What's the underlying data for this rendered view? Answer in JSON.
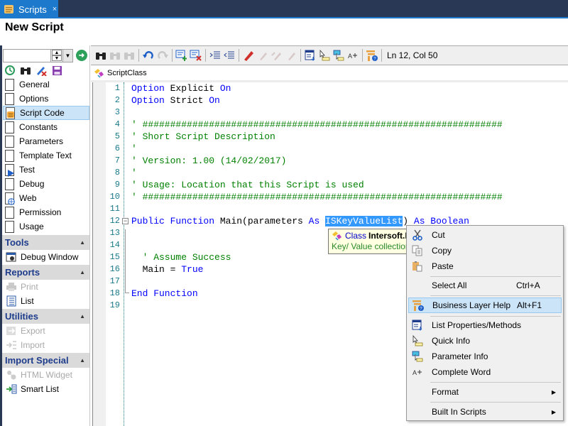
{
  "tab": {
    "label": "Scripts",
    "close_glyph": "×",
    "icon": "scroll-icon"
  },
  "document": {
    "title": "New Script"
  },
  "left_panel": {
    "search": {
      "value": "",
      "placeholder": ""
    },
    "tools_icons": [
      "history-icon",
      "binoculars-icon",
      "edit-delete-icon",
      "save-icon"
    ],
    "nav_items": [
      {
        "label": "General",
        "icon": "checkbox-icon",
        "selected": false
      },
      {
        "label": "Options",
        "icon": "checkbox-icon",
        "selected": false
      },
      {
        "label": "Script Code",
        "icon": "script-code-icon",
        "selected": true
      },
      {
        "label": "Constants",
        "icon": "checkbox-icon",
        "selected": false
      },
      {
        "label": "Parameters",
        "icon": "checkbox-icon",
        "selected": false
      },
      {
        "label": "Template Text",
        "icon": "checkbox-icon",
        "selected": false
      },
      {
        "label": "Test",
        "icon": "play-page-icon",
        "selected": false
      },
      {
        "label": "Debug",
        "icon": "checkbox-icon",
        "selected": false
      },
      {
        "label": "Web",
        "icon": "globe-page-icon",
        "selected": false
      },
      {
        "label": "Permission",
        "icon": "checkbox-icon",
        "selected": false
      },
      {
        "label": "Usage",
        "icon": "checkbox-icon",
        "selected": false
      }
    ],
    "sections": [
      {
        "title": "Tools",
        "caret": "▲",
        "items": [
          {
            "label": "Debug Window",
            "icon": "debug-window-icon",
            "enabled": true
          }
        ]
      },
      {
        "title": "Reports",
        "caret": "▲",
        "items": [
          {
            "label": "Print",
            "icon": "printer-icon",
            "enabled": false
          },
          {
            "label": "List",
            "icon": "list-icon",
            "enabled": true
          }
        ]
      },
      {
        "title": "Utilities",
        "caret": "▲",
        "items": [
          {
            "label": "Export",
            "icon": "export-icon",
            "enabled": false
          },
          {
            "label": "Import",
            "icon": "import-icon",
            "enabled": false
          }
        ]
      },
      {
        "title": "Import Special",
        "caret": "▲",
        "items": [
          {
            "label": "HTML Widget",
            "icon": "html-widget-icon",
            "enabled": false
          },
          {
            "label": "Smart List",
            "icon": "smart-list-icon",
            "enabled": true
          }
        ]
      }
    ]
  },
  "toolbar": {
    "buttons": [
      "find-icon",
      "find-previous-icon",
      "find-next-icon",
      "undo-icon",
      "redo-icon",
      "comment-icon",
      "uncomment-icon",
      "indent-icon",
      "outdent-icon",
      "bookmark-icon",
      "prev-bookmark-icon",
      "next-bookmark-icon",
      "clear-bookmarks-icon",
      "list-members-icon",
      "quick-info-icon",
      "parameter-info-icon",
      "complete-word-icon",
      "business-layer-help-icon"
    ],
    "status": "Ln 12, Col 50"
  },
  "class_bar": {
    "label": "ScriptClass"
  },
  "editor": {
    "lines": [
      {
        "n": "1",
        "tokens": [
          {
            "t": "Option",
            "c": "kw"
          },
          {
            "t": " Explicit ",
            "c": "id"
          },
          {
            "t": "On",
            "c": "kw"
          }
        ]
      },
      {
        "n": "2",
        "tokens": [
          {
            "t": "Option",
            "c": "kw"
          },
          {
            "t": " Strict ",
            "c": "id"
          },
          {
            "t": "On",
            "c": "kw"
          }
        ]
      },
      {
        "n": "3",
        "tokens": []
      },
      {
        "n": "4",
        "tokens": [
          {
            "t": "' #################################################################",
            "c": "cm"
          }
        ]
      },
      {
        "n": "5",
        "tokens": [
          {
            "t": "' Short Script Description",
            "c": "cm"
          }
        ]
      },
      {
        "n": "6",
        "tokens": [
          {
            "t": "'",
            "c": "cm"
          }
        ]
      },
      {
        "n": "7",
        "tokens": [
          {
            "t": "' Version: 1.00 (14/02/2017)",
            "c": "cm"
          }
        ]
      },
      {
        "n": "8",
        "tokens": [
          {
            "t": "'",
            "c": "cm"
          }
        ]
      },
      {
        "n": "9",
        "tokens": [
          {
            "t": "' Usage: Location that this Script is used",
            "c": "cm"
          }
        ]
      },
      {
        "n": "10",
        "tokens": [
          {
            "t": "' #################################################################",
            "c": "cm"
          }
        ]
      },
      {
        "n": "11",
        "tokens": []
      },
      {
        "n": "12",
        "tokens": [
          {
            "t": "Public Function",
            "c": "kw"
          },
          {
            "t": " Main(parameters ",
            "c": "id"
          },
          {
            "t": "As",
            "c": "kw"
          },
          {
            "t": " ",
            "c": "id"
          },
          {
            "t": "ISKeyValueList",
            "c": "sel"
          },
          {
            "t": ") ",
            "c": "id"
          },
          {
            "t": "As Boolean",
            "c": "kw"
          }
        ]
      },
      {
        "n": "13",
        "tokens": []
      },
      {
        "n": "14",
        "tokens": []
      },
      {
        "n": "15",
        "tokens": [
          {
            "t": "  ' Assume Success",
            "c": "cm"
          }
        ]
      },
      {
        "n": "16",
        "tokens": [
          {
            "t": "  Main = ",
            "c": "id"
          },
          {
            "t": "True",
            "c": "kw"
          }
        ]
      },
      {
        "n": "17",
        "tokens": []
      },
      {
        "n": "18",
        "tokens": [
          {
            "t": "End Function",
            "c": "kw"
          }
        ]
      },
      {
        "n": "19",
        "tokens": []
      }
    ]
  },
  "tooltip": {
    "kind": "Class",
    "name": "Intersoft.I",
    "description": "Key/ Value collection"
  },
  "context_menu": {
    "items": [
      {
        "label": "Cut",
        "shortcut": "",
        "icon": "scissors-icon",
        "submenu": false,
        "highlighted": false
      },
      {
        "label": "Copy",
        "shortcut": "",
        "icon": "copy-icon",
        "submenu": false,
        "highlighted": false
      },
      {
        "label": "Paste",
        "shortcut": "",
        "icon": "paste-icon",
        "submenu": false,
        "highlighted": false
      },
      {
        "label": "Select All",
        "shortcut": "Ctrl+A",
        "icon": "",
        "submenu": false,
        "highlighted": false
      },
      {
        "label": "Business Layer Help",
        "shortcut": "Alt+F1",
        "icon": "business-layer-help-icon",
        "submenu": false,
        "highlighted": true
      },
      {
        "label": "List Properties/Methods",
        "shortcut": "",
        "icon": "list-members-icon",
        "submenu": false,
        "highlighted": false
      },
      {
        "label": "Quick Info",
        "shortcut": "",
        "icon": "quick-info-icon",
        "submenu": false,
        "highlighted": false
      },
      {
        "label": "Parameter Info",
        "shortcut": "",
        "icon": "parameter-info-icon",
        "submenu": false,
        "highlighted": false
      },
      {
        "label": "Complete Word",
        "shortcut": "",
        "icon": "complete-word-icon",
        "submenu": false,
        "highlighted": false
      },
      {
        "label": "Format",
        "shortcut": "",
        "icon": "",
        "submenu": true,
        "highlighted": false
      },
      {
        "label": "Built In Scripts",
        "shortcut": "",
        "icon": "",
        "submenu": true,
        "highlighted": false
      }
    ],
    "submenu_glyph": "▶"
  },
  "colors": {
    "title_bar": "#293955",
    "accent": "#1c79cc",
    "keyword": "#0000ff",
    "comment": "#008000",
    "selection": "#3399ff",
    "section_title": "#1e3c8c"
  }
}
